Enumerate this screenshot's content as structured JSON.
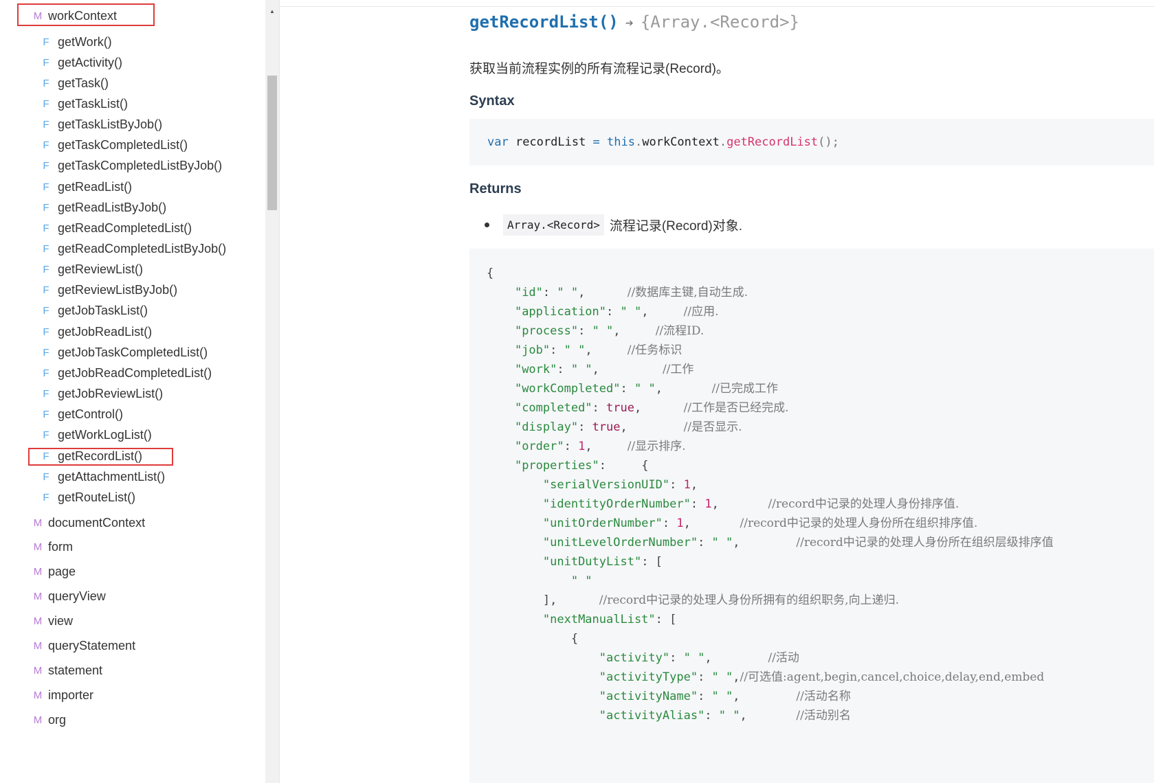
{
  "sidebar": {
    "scroll_up_icon": "▲",
    "work_context": {
      "badge": "M",
      "label": "workContext"
    },
    "functions": [
      {
        "badge": "F",
        "label": "getWork()"
      },
      {
        "badge": "F",
        "label": "getActivity()"
      },
      {
        "badge": "F",
        "label": "getTask()"
      },
      {
        "badge": "F",
        "label": "getTaskList()"
      },
      {
        "badge": "F",
        "label": "getTaskListByJob()"
      },
      {
        "badge": "F",
        "label": "getTaskCompletedList()"
      },
      {
        "badge": "F",
        "label": "getTaskCompletedListByJob()"
      },
      {
        "badge": "F",
        "label": "getReadList()"
      },
      {
        "badge": "F",
        "label": "getReadListByJob()"
      },
      {
        "badge": "F",
        "label": "getReadCompletedList()"
      },
      {
        "badge": "F",
        "label": "getReadCompletedListByJob()"
      },
      {
        "badge": "F",
        "label": "getReviewList()"
      },
      {
        "badge": "F",
        "label": "getReviewListByJob()"
      },
      {
        "badge": "F",
        "label": "getJobTaskList()"
      },
      {
        "badge": "F",
        "label": "getJobReadList()"
      },
      {
        "badge": "F",
        "label": "getJobTaskCompletedList()"
      },
      {
        "badge": "F",
        "label": "getJobReadCompletedList()"
      },
      {
        "badge": "F",
        "label": "getJobReviewList()"
      },
      {
        "badge": "F",
        "label": "getControl()"
      },
      {
        "badge": "F",
        "label": "getWorkLogList()"
      },
      {
        "badge": "F",
        "label": "getRecordList()"
      },
      {
        "badge": "F",
        "label": "getAttachmentList()"
      },
      {
        "badge": "F",
        "label": "getRouteList()"
      }
    ],
    "modules": [
      {
        "badge": "M",
        "label": "documentContext"
      },
      {
        "badge": "M",
        "label": "form"
      },
      {
        "badge": "M",
        "label": "page"
      },
      {
        "badge": "M",
        "label": "queryView"
      },
      {
        "badge": "M",
        "label": "view"
      },
      {
        "badge": "M",
        "label": "queryStatement"
      },
      {
        "badge": "M",
        "label": "statement"
      },
      {
        "badge": "M",
        "label": "importer"
      },
      {
        "badge": "M",
        "label": "org"
      }
    ]
  },
  "main": {
    "title_fn": "getRecordList()",
    "title_arrow": "➔",
    "title_return": "{Array.<Record>}",
    "description": "获取当前流程实例的所有流程记录(Record)。",
    "syntax_heading": "Syntax",
    "syntax": {
      "var_kw": "var",
      "var_name": " recordList ",
      "eq": "=",
      "this_kw": " this",
      "dot1": ".",
      "ctx": "workContext",
      "dot2": ".",
      "method": "getRecordList",
      "tail": "();"
    },
    "returns_heading": "Returns",
    "returns_type": "Array.<Record>",
    "returns_desc": "流程记录(Record)对象."
  },
  "code_lines": [
    [
      {
        "t": "p",
        "v": "{"
      }
    ],
    [
      {
        "t": "p",
        "v": "    "
      },
      {
        "t": "s",
        "v": "\"id\""
      },
      {
        "t": "p",
        "v": ": "
      },
      {
        "t": "s",
        "v": "\" \""
      },
      {
        "t": "p",
        "v": ",      "
      },
      {
        "t": "c",
        "v": "//数据库主键,自动生成."
      }
    ],
    [
      {
        "t": "p",
        "v": "    "
      },
      {
        "t": "s",
        "v": "\"application\""
      },
      {
        "t": "p",
        "v": ": "
      },
      {
        "t": "s",
        "v": "\" \""
      },
      {
        "t": "p",
        "v": ",     "
      },
      {
        "t": "c",
        "v": "//应用."
      }
    ],
    [
      {
        "t": "p",
        "v": "    "
      },
      {
        "t": "s",
        "v": "\"process\""
      },
      {
        "t": "p",
        "v": ": "
      },
      {
        "t": "s",
        "v": "\" \""
      },
      {
        "t": "p",
        "v": ",     "
      },
      {
        "t": "c",
        "v": "//流程ID."
      }
    ],
    [
      {
        "t": "p",
        "v": "    "
      },
      {
        "t": "s",
        "v": "\"job\""
      },
      {
        "t": "p",
        "v": ": "
      },
      {
        "t": "s",
        "v": "\" \""
      },
      {
        "t": "p",
        "v": ",     "
      },
      {
        "t": "c",
        "v": "//任务标识"
      }
    ],
    [
      {
        "t": "p",
        "v": "    "
      },
      {
        "t": "s",
        "v": "\"work\""
      },
      {
        "t": "p",
        "v": ": "
      },
      {
        "t": "s",
        "v": "\" \""
      },
      {
        "t": "p",
        "v": ",         "
      },
      {
        "t": "c",
        "v": "//工作"
      }
    ],
    [
      {
        "t": "p",
        "v": "    "
      },
      {
        "t": "s",
        "v": "\"workCompleted\""
      },
      {
        "t": "p",
        "v": ": "
      },
      {
        "t": "s",
        "v": "\" \""
      },
      {
        "t": "p",
        "v": ",       "
      },
      {
        "t": "c",
        "v": "//已完成工作"
      }
    ],
    [
      {
        "t": "p",
        "v": "    "
      },
      {
        "t": "s",
        "v": "\"completed\""
      },
      {
        "t": "p",
        "v": ": "
      },
      {
        "t": "b",
        "v": "true"
      },
      {
        "t": "p",
        "v": ",      "
      },
      {
        "t": "c",
        "v": "//工作是否已经完成."
      }
    ],
    [
      {
        "t": "p",
        "v": "    "
      },
      {
        "t": "s",
        "v": "\"display\""
      },
      {
        "t": "p",
        "v": ": "
      },
      {
        "t": "b",
        "v": "true"
      },
      {
        "t": "p",
        "v": ",        "
      },
      {
        "t": "c",
        "v": "//是否显示."
      }
    ],
    [
      {
        "t": "p",
        "v": "    "
      },
      {
        "t": "s",
        "v": "\"order\""
      },
      {
        "t": "p",
        "v": ": "
      },
      {
        "t": "n",
        "v": "1"
      },
      {
        "t": "p",
        "v": ",     "
      },
      {
        "t": "c",
        "v": "//显示排序."
      }
    ],
    [
      {
        "t": "p",
        "v": "    "
      },
      {
        "t": "s",
        "v": "\"properties\""
      },
      {
        "t": "p",
        "v": ":     {"
      }
    ],
    [
      {
        "t": "p",
        "v": "        "
      },
      {
        "t": "s",
        "v": "\"serialVersionUID\""
      },
      {
        "t": "p",
        "v": ": "
      },
      {
        "t": "n",
        "v": "1"
      },
      {
        "t": "p",
        "v": ","
      }
    ],
    [
      {
        "t": "p",
        "v": "        "
      },
      {
        "t": "s",
        "v": "\"identityOrderNumber\""
      },
      {
        "t": "p",
        "v": ": "
      },
      {
        "t": "n",
        "v": "1"
      },
      {
        "t": "p",
        "v": ",       "
      },
      {
        "t": "c",
        "v": "//record中记录的处理人身份排序值."
      }
    ],
    [
      {
        "t": "p",
        "v": "        "
      },
      {
        "t": "s",
        "v": "\"unitOrderNumber\""
      },
      {
        "t": "p",
        "v": ": "
      },
      {
        "t": "n",
        "v": "1"
      },
      {
        "t": "p",
        "v": ",       "
      },
      {
        "t": "c",
        "v": "//record中记录的处理人身份所在组织排序值."
      }
    ],
    [
      {
        "t": "p",
        "v": "        "
      },
      {
        "t": "s",
        "v": "\"unitLevelOrderNumber\""
      },
      {
        "t": "p",
        "v": ": "
      },
      {
        "t": "s",
        "v": "\" \""
      },
      {
        "t": "p",
        "v": ",        "
      },
      {
        "t": "c",
        "v": "//record中记录的处理人身份所在组织层级排序值"
      }
    ],
    [
      {
        "t": "p",
        "v": "        "
      },
      {
        "t": "s",
        "v": "\"unitDutyList\""
      },
      {
        "t": "p",
        "v": ": ["
      }
    ],
    [
      {
        "t": "p",
        "v": "            "
      },
      {
        "t": "s",
        "v": "\" \""
      }
    ],
    [
      {
        "t": "p",
        "v": "        ],      "
      },
      {
        "t": "c",
        "v": "//record中记录的处理人身份所拥有的组织职务,向上递归."
      }
    ],
    [
      {
        "t": "p",
        "v": "        "
      },
      {
        "t": "s",
        "v": "\"nextManualList\""
      },
      {
        "t": "p",
        "v": ": ["
      }
    ],
    [
      {
        "t": "p",
        "v": "            {"
      }
    ],
    [
      {
        "t": "p",
        "v": "                "
      },
      {
        "t": "s",
        "v": "\"activity\""
      },
      {
        "t": "p",
        "v": ": "
      },
      {
        "t": "s",
        "v": "\" \""
      },
      {
        "t": "p",
        "v": ",        "
      },
      {
        "t": "c",
        "v": "//活动"
      }
    ],
    [
      {
        "t": "p",
        "v": "                "
      },
      {
        "t": "s",
        "v": "\"activityType\""
      },
      {
        "t": "p",
        "v": ": "
      },
      {
        "t": "s",
        "v": "\" \""
      },
      {
        "t": "p",
        "v": ","
      },
      {
        "t": "c",
        "v": "//可选值:agent,begin,cancel,choice,delay,end,embed"
      }
    ],
    [
      {
        "t": "p",
        "v": "                "
      },
      {
        "t": "s",
        "v": "\"activityName\""
      },
      {
        "t": "p",
        "v": ": "
      },
      {
        "t": "s",
        "v": "\" \""
      },
      {
        "t": "p",
        "v": ",        "
      },
      {
        "t": "c",
        "v": "//活动名称"
      }
    ],
    [
      {
        "t": "p",
        "v": "                "
      },
      {
        "t": "s",
        "v": "\"activityAlias\""
      },
      {
        "t": "p",
        "v": ": "
      },
      {
        "t": "s",
        "v": "\" \""
      },
      {
        "t": "p",
        "v": ",       "
      },
      {
        "t": "c",
        "v": "//活动别名"
      }
    ]
  ]
}
